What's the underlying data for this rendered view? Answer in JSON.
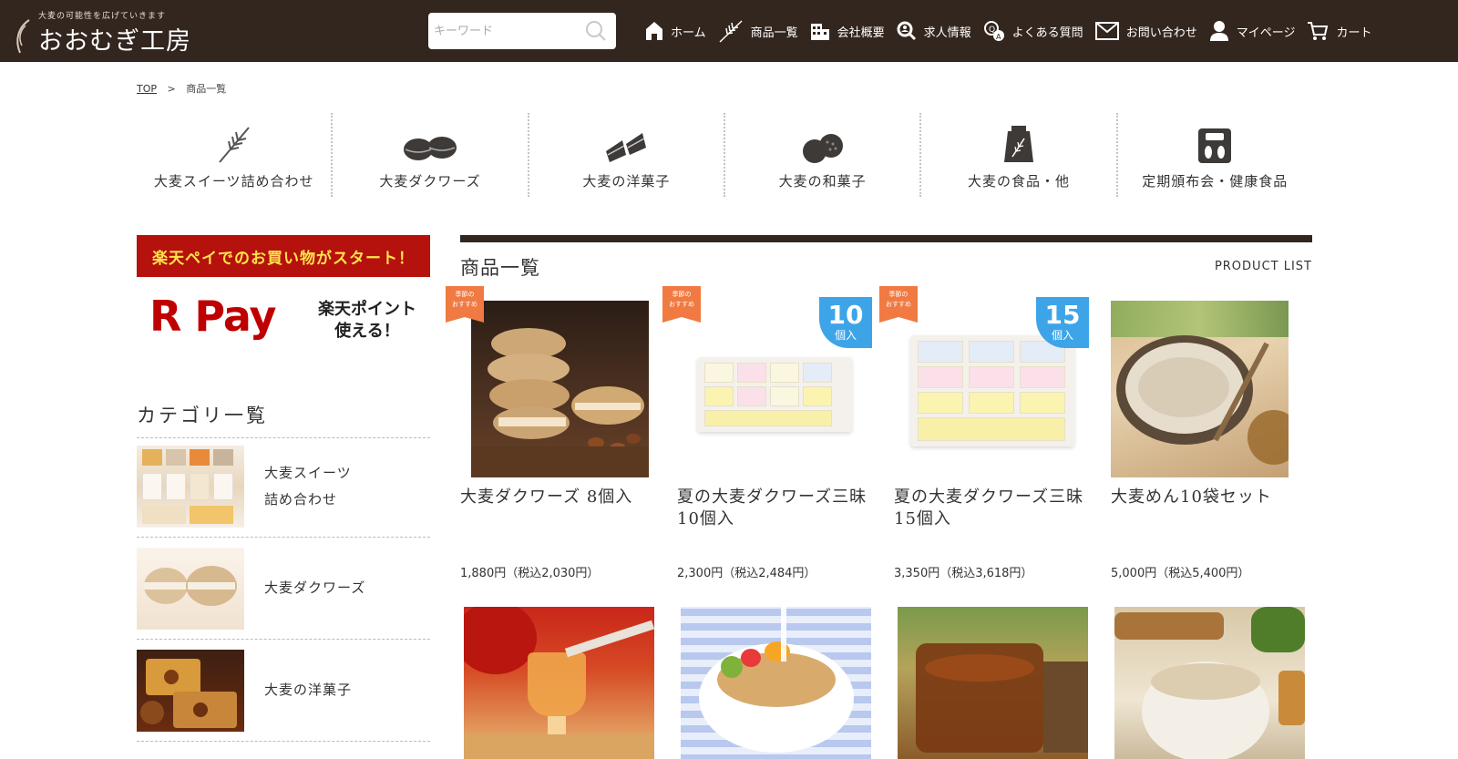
{
  "header": {
    "logo_tagline": "大麦の可能性を広げていきます",
    "logo_name": "おおむぎ工房",
    "search_placeholder": "キーワード",
    "nav": [
      {
        "label": "ホーム",
        "icon": "home-icon"
      },
      {
        "label": "商品一覧",
        "icon": "wheat-icon"
      },
      {
        "label": "会社概要",
        "icon": "building-icon"
      },
      {
        "label": "求人情報",
        "icon": "magnifier-person-icon"
      },
      {
        "label": "よくある質問",
        "icon": "faq-icon"
      },
      {
        "label": "お問い合わせ",
        "icon": "mail-icon"
      },
      {
        "label": "マイページ",
        "icon": "user-icon"
      },
      {
        "label": "カート",
        "icon": "cart-icon"
      }
    ]
  },
  "breadcrumb": {
    "home": "TOP",
    "separator": ">",
    "current": "商品一覧"
  },
  "categories": [
    {
      "label": "大麦スイーツ詰め合わせ",
      "icon": "wheat-icon"
    },
    {
      "label": "大麦ダクワーズ",
      "icon": "dacquoise-icon"
    },
    {
      "label": "大麦の洋菓子",
      "icon": "cake-icon"
    },
    {
      "label": "大麦の和菓子",
      "icon": "wagashi-icon"
    },
    {
      "label": "大麦の食品・他",
      "icon": "food-bag-icon"
    },
    {
      "label": "定期頒布会・健康食品",
      "icon": "scale-icon"
    }
  ],
  "sidebar": {
    "promo_banner": "楽天ペイでのお買い物がスタート！",
    "rpay_logo": "R Pay",
    "rpay_text_1": "楽天ポイント",
    "rpay_text_2": "使える！",
    "category_title": "カテゴリ一覧",
    "items": [
      {
        "label_1": "大麦スイーツ",
        "label_2": "詰め合わせ"
      },
      {
        "label_1": "大麦ダクワーズ",
        "label_2": ""
      },
      {
        "label_1": "大麦の洋菓子",
        "label_2": ""
      }
    ]
  },
  "main": {
    "title": "商品一覧",
    "subtitle": "PRODUCT LIST",
    "season_badge_1": "季節の",
    "season_badge_2": "おすすめ",
    "count_unit": "個入",
    "products": [
      {
        "name": "大麦ダクワーズ 8個入",
        "price": "1,880円（税込2,030円）",
        "season": true,
        "count": ""
      },
      {
        "name": "夏の大麦ダクワーズ三昧 10個入",
        "price": "2,300円（税込2,484円）",
        "season": true,
        "count": "10"
      },
      {
        "name": "夏の大麦ダクワーズ三昧 15個入",
        "price": "3,350円（税込3,618円）",
        "season": true,
        "count": "15"
      },
      {
        "name": "大麦めん10袋セット",
        "price": "5,000円（税込5,400円）",
        "season": false,
        "count": ""
      }
    ]
  },
  "colors": {
    "header_bg": "#33261f",
    "promo_red": "#b5110d",
    "promo_yellow": "#ffe34a",
    "season_orange": "#f07a41",
    "count_blue": "#3da4e8"
  }
}
